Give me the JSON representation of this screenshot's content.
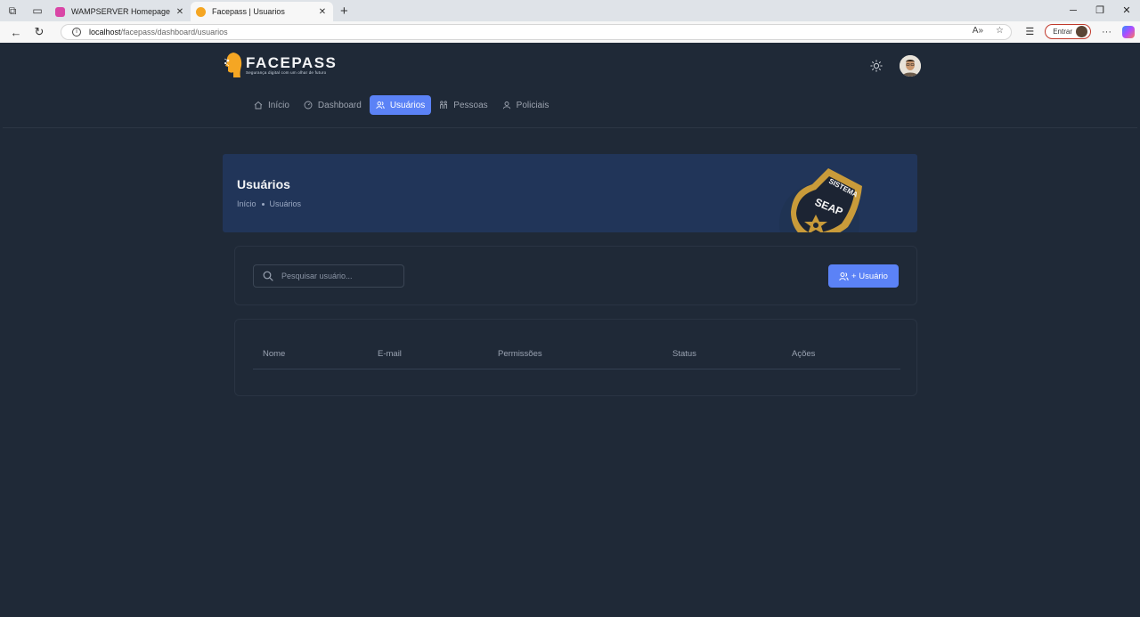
{
  "browser": {
    "tabs": [
      {
        "title": "WAMPSERVER Homepage",
        "active": false,
        "favicon_color": "#d946a6"
      },
      {
        "title": "Facepass | Usuarios",
        "active": true,
        "favicon_color": "#f5a623"
      }
    ],
    "url_host": "localhost",
    "url_path": "/facepass/dashboard/usuarios",
    "signin_label": "Entrar"
  },
  "brand": {
    "name": "FACEPASS",
    "tagline": "Segurança digital com um olhar de futuro",
    "accent": "#f5a623"
  },
  "nav": {
    "items": [
      {
        "label": "Início",
        "icon": "home-icon",
        "active": false
      },
      {
        "label": "Dashboard",
        "icon": "gauge-icon",
        "active": false
      },
      {
        "label": "Usuários",
        "icon": "users-icon",
        "active": true
      },
      {
        "label": "Pessoas",
        "icon": "people-icon",
        "active": false
      },
      {
        "label": "Policiais",
        "icon": "officer-icon",
        "active": false
      }
    ],
    "active_color": "#5b82f6"
  },
  "banner": {
    "title": "Usuários",
    "breadcrumb": [
      "Início",
      "Usuários"
    ],
    "badge_top": "SISTEMA",
    "badge_word": "SEAP"
  },
  "search": {
    "placeholder": "Pesquisar usuário..."
  },
  "actions": {
    "add_user_label": "+ Usuário"
  },
  "table": {
    "columns": [
      "Nome",
      "E-mail",
      "Permissões",
      "Status",
      "Ações"
    ],
    "rows": []
  }
}
